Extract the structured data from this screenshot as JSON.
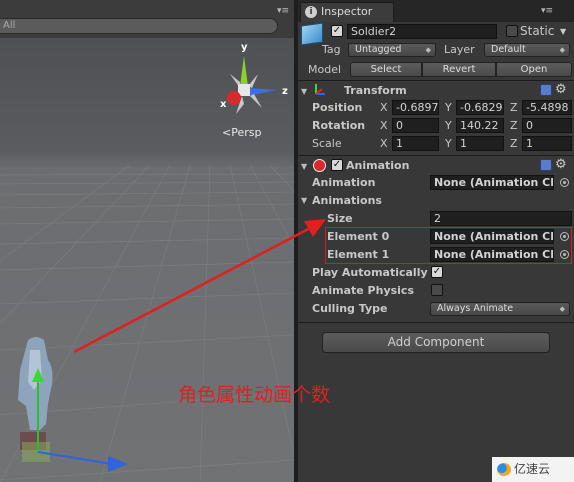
{
  "scene": {
    "search_text": "All",
    "persp_label": "<Persp",
    "gizmo": {
      "y": "y",
      "x": "x",
      "z": "z"
    }
  },
  "inspector": {
    "tab_label": "Inspector",
    "tab_icon": "info-icon",
    "object": {
      "name": "Soldier2",
      "active_checked": true,
      "static_label": "Static",
      "static_checked": false,
      "tag_label": "Tag",
      "tag_value": "Untagged",
      "layer_label": "Layer",
      "layer_value": "Default",
      "model_label": "Model",
      "model_buttons": [
        "Select",
        "Revert",
        "Open"
      ]
    },
    "transform": {
      "title": "Transform",
      "position_label": "Position",
      "position": {
        "x": "-0.6897",
        "y": "-0.6829",
        "z": "-5.4898"
      },
      "rotation_label": "Rotation",
      "rotation": {
        "x": "0",
        "y": "140.22",
        "z": "0"
      },
      "scale_label": "Scale",
      "scale": {
        "x": "1",
        "y": "1",
        "z": "1"
      },
      "axis_x": "X",
      "axis_y": "Y",
      "axis_z": "Z"
    },
    "animation": {
      "title": "Animation",
      "enabled": true,
      "animation_label": "Animation",
      "animation_value": "None (Animation Clip)",
      "animations_label": "Animations",
      "size_label": "Size",
      "size_value": "2",
      "elements": [
        {
          "label": "Element 0",
          "value": "None (Animation Clip)"
        },
        {
          "label": "Element 1",
          "value": "None (Animation Clip)"
        }
      ],
      "play_auto_label": "Play Automatically",
      "play_auto_checked": true,
      "animate_physics_label": "Animate Physics",
      "animate_physics_checked": false,
      "culling_label": "Culling Type",
      "culling_value": "Always Animate"
    },
    "add_component_label": "Add Component"
  },
  "annotation": {
    "text": "角色属性动画个数",
    "color": "#e02020"
  },
  "watermark": {
    "text": "亿速云"
  }
}
